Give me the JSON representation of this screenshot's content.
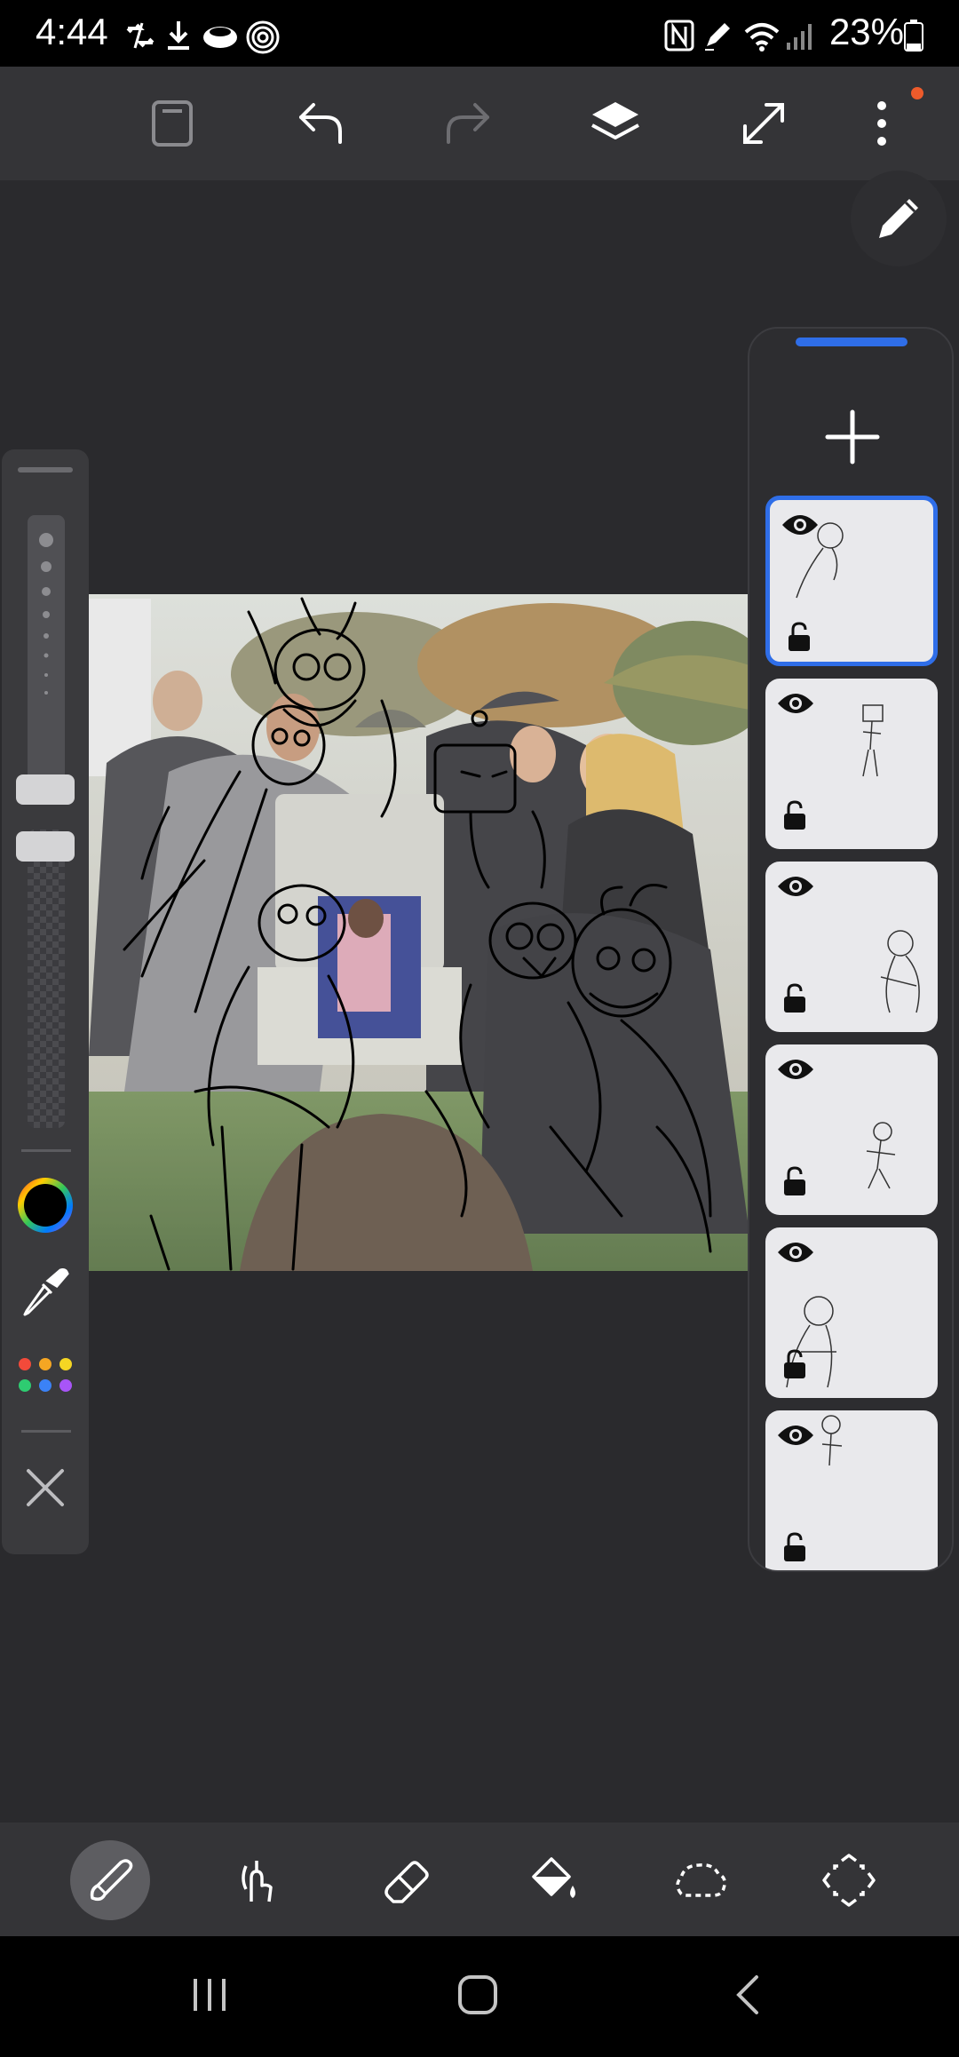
{
  "status_bar": {
    "time": "4:44",
    "battery": "23%",
    "left_icons": [
      "sync-icon",
      "download-icon",
      "cloud-icon",
      "fingerprint-icon"
    ],
    "right_icons": [
      "nfc-icon",
      "pen-icon",
      "wifi-icon",
      "signal-icon",
      "battery-icon"
    ]
  },
  "toolbar": {
    "buttons": [
      "gallery",
      "undo",
      "redo",
      "layers",
      "fullscreen",
      "more"
    ],
    "has_notification": true,
    "accent_dot": "#ee5b2b"
  },
  "canvas": {
    "description_icons": [
      "photo-with-sketches"
    ]
  },
  "left_tools": {
    "brush_size": 0.12,
    "opacity": 0.06,
    "color_icon": "color-wheel-icon",
    "eyedropper_icon": "eyedropper-icon",
    "palette_dots": [
      "#f24a3a",
      "#f5a623",
      "#f5d623",
      "#2ecc71",
      "#3b82f6",
      "#a855f7"
    ],
    "close_icon": "close-icon"
  },
  "layers_panel": {
    "accent": "#2f6ee8",
    "layer_count_visible": 6,
    "selected_index": 0
  },
  "bottom_tools": {
    "tools": [
      "brush",
      "smudge",
      "eraser",
      "fill",
      "lasso",
      "transform"
    ],
    "active": "brush"
  },
  "nav_bar": {
    "buttons": [
      "recents",
      "home",
      "back"
    ]
  }
}
